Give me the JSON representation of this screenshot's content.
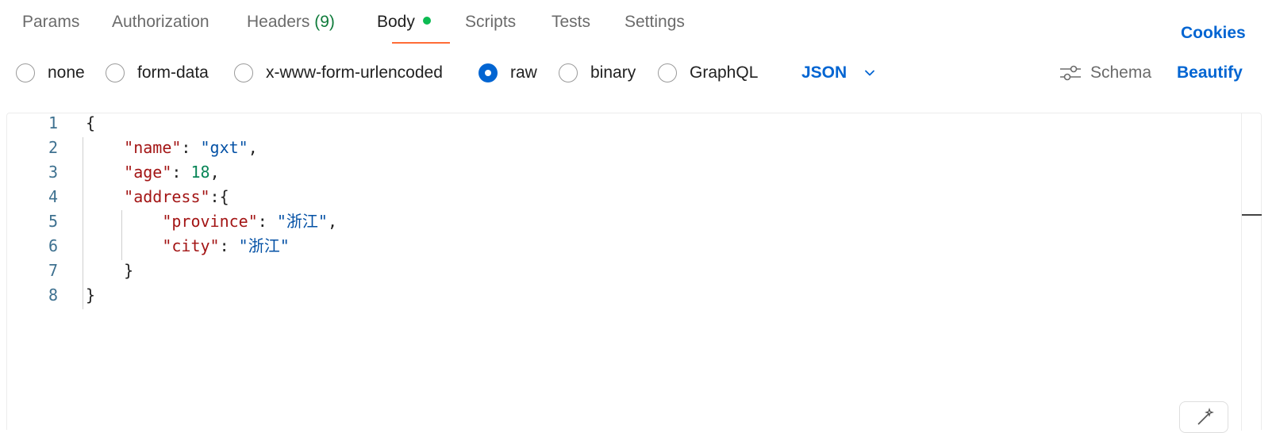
{
  "tabs": [
    {
      "label": "Params"
    },
    {
      "label": "Authorization"
    },
    {
      "label": "Headers",
      "count": "(9)"
    },
    {
      "label": "Body",
      "active": true,
      "indicator": "green-dot"
    },
    {
      "label": "Scripts"
    },
    {
      "label": "Tests"
    },
    {
      "label": "Settings"
    }
  ],
  "cookies_label": "Cookies",
  "body_types": [
    {
      "label": "none",
      "checked": false
    },
    {
      "label": "form-data",
      "checked": false
    },
    {
      "label": "x-www-form-urlencoded",
      "checked": false
    },
    {
      "label": "raw",
      "checked": true
    },
    {
      "label": "binary",
      "checked": false
    },
    {
      "label": "GraphQL",
      "checked": false
    }
  ],
  "format_select": {
    "value": "JSON",
    "icon": "chevron-down-icon"
  },
  "schema_label": "Schema",
  "schema_icon": "sliders-icon",
  "beautify_label": "Beautify",
  "colors": {
    "accent": "#0265d2",
    "tab_underline": "#ff6c37",
    "body_dot": "#0cbb52",
    "headers_count": "#0f7b3b",
    "json_key": "#a31515",
    "json_string": "#0451a5",
    "json_number": "#098658",
    "line_number": "#3e7190"
  },
  "editor": {
    "language": "json",
    "lines": [
      {
        "num": "1",
        "tokens": [
          {
            "t": "p",
            "v": "{"
          }
        ]
      },
      {
        "num": "2",
        "tokens": [
          {
            "t": "p",
            "v": "    "
          },
          {
            "t": "k",
            "v": "\"name\""
          },
          {
            "t": "p",
            "v": ": "
          },
          {
            "t": "s",
            "v": "\"gxt\""
          },
          {
            "t": "p",
            "v": ","
          }
        ]
      },
      {
        "num": "3",
        "tokens": [
          {
            "t": "p",
            "v": "    "
          },
          {
            "t": "k",
            "v": "\"age\""
          },
          {
            "t": "p",
            "v": ": "
          },
          {
            "t": "n",
            "v": "18"
          },
          {
            "t": "p",
            "v": ","
          }
        ]
      },
      {
        "num": "4",
        "tokens": [
          {
            "t": "p",
            "v": "    "
          },
          {
            "t": "k",
            "v": "\"address\""
          },
          {
            "t": "p",
            "v": ":{"
          }
        ]
      },
      {
        "num": "5",
        "tokens": [
          {
            "t": "p",
            "v": "        "
          },
          {
            "t": "k",
            "v": "\"province\""
          },
          {
            "t": "p",
            "v": ": "
          },
          {
            "t": "s",
            "v": "\"浙江\""
          },
          {
            "t": "p",
            "v": ","
          }
        ]
      },
      {
        "num": "6",
        "tokens": [
          {
            "t": "p",
            "v": "        "
          },
          {
            "t": "k",
            "v": "\"city\""
          },
          {
            "t": "p",
            "v": ": "
          },
          {
            "t": "s",
            "v": "\"浙江\""
          }
        ]
      },
      {
        "num": "7",
        "tokens": [
          {
            "t": "p",
            "v": "    }"
          }
        ]
      },
      {
        "num": "8",
        "tokens": [
          {
            "t": "p",
            "v": "}"
          }
        ]
      }
    ]
  }
}
